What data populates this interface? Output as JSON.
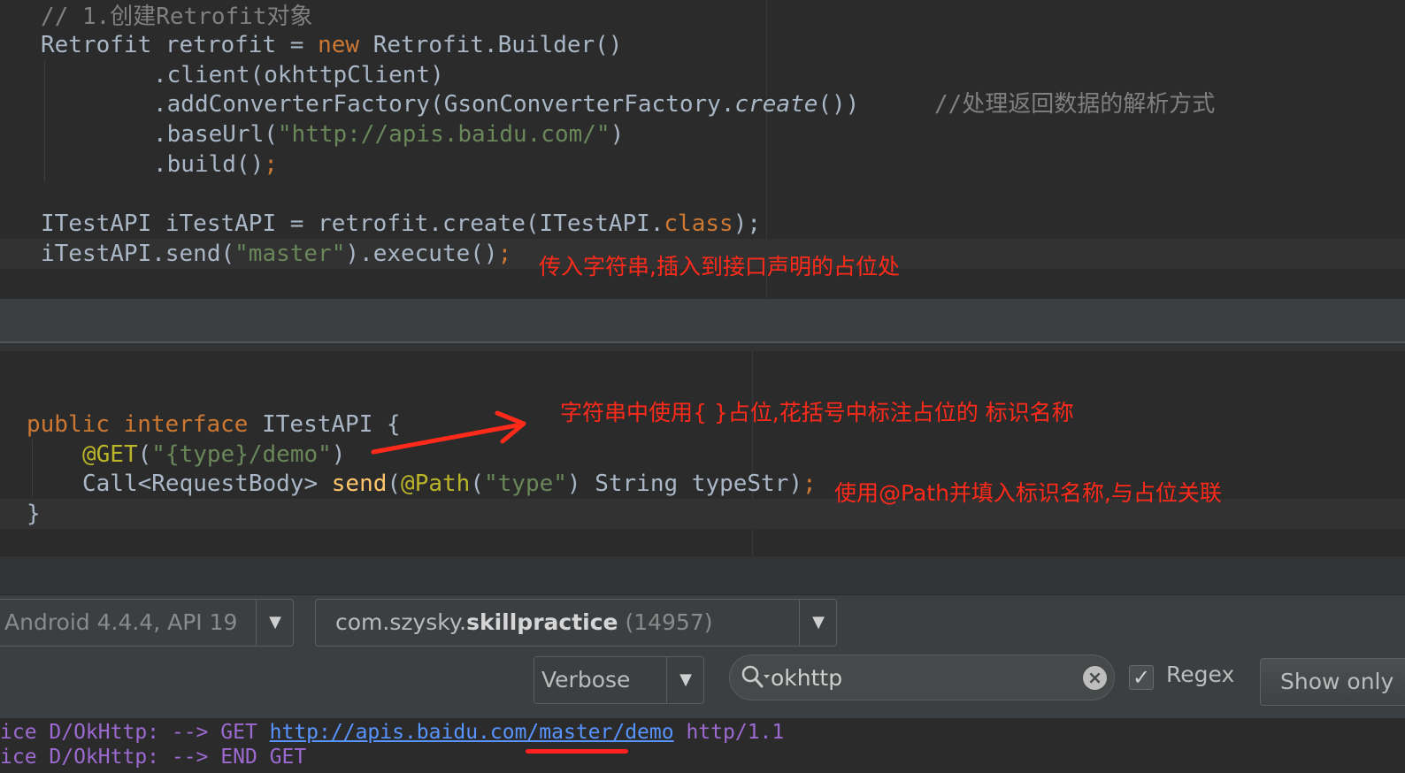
{
  "editor_top": {
    "comment_line": "// 1.创建Retrofit对象",
    "line2_a": "Retrofit retrofit = ",
    "line2_kw": "new",
    "line2_b": " Retrofit.Builder()",
    "line3": ".client(okhttpClient)",
    "line4_a": ".addConverterFactory(GsonConverterFactory.",
    "line4_ital": "create",
    "line4_b": "())",
    "line4_comment": "//处理返回数据的解析方式",
    "line5_a": ".baseUrl(",
    "line5_str": "\"http://apis.baidu.com/\"",
    "line5_b": ")",
    "line6_a": ".build()",
    "line6_semi": ";",
    "line8_a": "ITestAPI iTestAPI = retrofit.create(ITestAPI.",
    "line8_kw": "class",
    "line8_b": ");",
    "line9_a": "iTestAPI.send(",
    "line9_str": "\"master\"",
    "line9_b": ").execute()",
    "line9_semi": ";",
    "annotation": "传入字符串,插入到接口声明的占位处"
  },
  "editor_bottom": {
    "line1_kw1": "public",
    "line1_kw2": "interface",
    "line1_b": " ITestAPI {",
    "line2_ann": "@GET",
    "line2_a": "(",
    "line2_str": "\"{type}/demo\"",
    "line2_b": ")",
    "line3_a": "Call<RequestBody> ",
    "line3_fn": "send",
    "line3_b": "(",
    "line3_ann": "@Path",
    "line3_c": "(",
    "line3_str": "\"type\"",
    "line3_d": ") String typeStr)",
    "line3_semi": ";",
    "line4": "}",
    "annotation_1": "字符串中使用{ }占位,花括号中标注占位的 标识名称",
    "annotation_2": "使用@Path并填入标识名称,与占位关联"
  },
  "logcat": {
    "device_label": "Android 4.4.4, API 19",
    "process_prefix": "com.szysky.",
    "process_bold": "skillpractice",
    "process_pid": " (14957)",
    "level": "Verbose",
    "search_value": "okhttp",
    "regex_label": "Regex",
    "regex_checked": true,
    "show_only_label": "Show only",
    "log_line1_a": "ice D/OkHttp: --> GET ",
    "log_line1_url": "http://apis.baidu.com/master/demo",
    "log_line1_b": " http/1.1",
    "log_line2": "ice D/OkHttp: --> END GET"
  },
  "colors": {
    "background": "#2b2b2b",
    "keyword": "#cc7832",
    "string": "#6a8759",
    "annotation_red": "#ff2a1a",
    "log_purple": "#9c6ad1",
    "link_blue": "#5894ff"
  }
}
